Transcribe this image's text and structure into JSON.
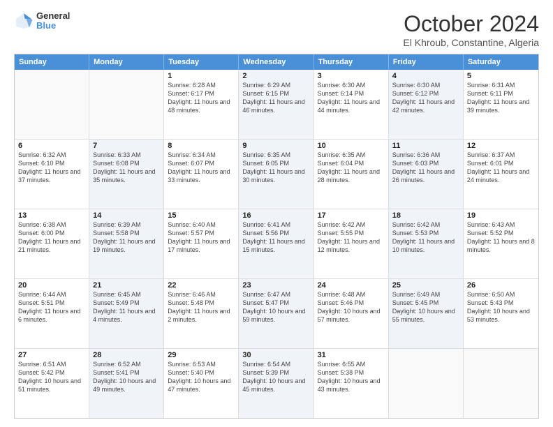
{
  "logo": {
    "line1": "General",
    "line2": "Blue"
  },
  "title": "October 2024",
  "subtitle": "El Khroub, Constantine, Algeria",
  "header_days": [
    "Sunday",
    "Monday",
    "Tuesday",
    "Wednesday",
    "Thursday",
    "Friday",
    "Saturday"
  ],
  "weeks": [
    [
      {
        "day": "",
        "sunrise": "",
        "sunset": "",
        "daylight": "",
        "shaded": false,
        "empty": true
      },
      {
        "day": "",
        "sunrise": "",
        "sunset": "",
        "daylight": "",
        "shaded": false,
        "empty": true
      },
      {
        "day": "1",
        "sunrise": "Sunrise: 6:28 AM",
        "sunset": "Sunset: 6:17 PM",
        "daylight": "Daylight: 11 hours and 48 minutes.",
        "shaded": false,
        "empty": false
      },
      {
        "day": "2",
        "sunrise": "Sunrise: 6:29 AM",
        "sunset": "Sunset: 6:15 PM",
        "daylight": "Daylight: 11 hours and 46 minutes.",
        "shaded": true,
        "empty": false
      },
      {
        "day": "3",
        "sunrise": "Sunrise: 6:30 AM",
        "sunset": "Sunset: 6:14 PM",
        "daylight": "Daylight: 11 hours and 44 minutes.",
        "shaded": false,
        "empty": false
      },
      {
        "day": "4",
        "sunrise": "Sunrise: 6:30 AM",
        "sunset": "Sunset: 6:12 PM",
        "daylight": "Daylight: 11 hours and 42 minutes.",
        "shaded": true,
        "empty": false
      },
      {
        "day": "5",
        "sunrise": "Sunrise: 6:31 AM",
        "sunset": "Sunset: 6:11 PM",
        "daylight": "Daylight: 11 hours and 39 minutes.",
        "shaded": false,
        "empty": false
      }
    ],
    [
      {
        "day": "6",
        "sunrise": "Sunrise: 6:32 AM",
        "sunset": "Sunset: 6:10 PM",
        "daylight": "Daylight: 11 hours and 37 minutes.",
        "shaded": false,
        "empty": false
      },
      {
        "day": "7",
        "sunrise": "Sunrise: 6:33 AM",
        "sunset": "Sunset: 6:08 PM",
        "daylight": "Daylight: 11 hours and 35 minutes.",
        "shaded": true,
        "empty": false
      },
      {
        "day": "8",
        "sunrise": "Sunrise: 6:34 AM",
        "sunset": "Sunset: 6:07 PM",
        "daylight": "Daylight: 11 hours and 33 minutes.",
        "shaded": false,
        "empty": false
      },
      {
        "day": "9",
        "sunrise": "Sunrise: 6:35 AM",
        "sunset": "Sunset: 6:05 PM",
        "daylight": "Daylight: 11 hours and 30 minutes.",
        "shaded": true,
        "empty": false
      },
      {
        "day": "10",
        "sunrise": "Sunrise: 6:35 AM",
        "sunset": "Sunset: 6:04 PM",
        "daylight": "Daylight: 11 hours and 28 minutes.",
        "shaded": false,
        "empty": false
      },
      {
        "day": "11",
        "sunrise": "Sunrise: 6:36 AM",
        "sunset": "Sunset: 6:03 PM",
        "daylight": "Daylight: 11 hours and 26 minutes.",
        "shaded": true,
        "empty": false
      },
      {
        "day": "12",
        "sunrise": "Sunrise: 6:37 AM",
        "sunset": "Sunset: 6:01 PM",
        "daylight": "Daylight: 11 hours and 24 minutes.",
        "shaded": false,
        "empty": false
      }
    ],
    [
      {
        "day": "13",
        "sunrise": "Sunrise: 6:38 AM",
        "sunset": "Sunset: 6:00 PM",
        "daylight": "Daylight: 11 hours and 21 minutes.",
        "shaded": false,
        "empty": false
      },
      {
        "day": "14",
        "sunrise": "Sunrise: 6:39 AM",
        "sunset": "Sunset: 5:58 PM",
        "daylight": "Daylight: 11 hours and 19 minutes.",
        "shaded": true,
        "empty": false
      },
      {
        "day": "15",
        "sunrise": "Sunrise: 6:40 AM",
        "sunset": "Sunset: 5:57 PM",
        "daylight": "Daylight: 11 hours and 17 minutes.",
        "shaded": false,
        "empty": false
      },
      {
        "day": "16",
        "sunrise": "Sunrise: 6:41 AM",
        "sunset": "Sunset: 5:56 PM",
        "daylight": "Daylight: 11 hours and 15 minutes.",
        "shaded": true,
        "empty": false
      },
      {
        "day": "17",
        "sunrise": "Sunrise: 6:42 AM",
        "sunset": "Sunset: 5:55 PM",
        "daylight": "Daylight: 11 hours and 12 minutes.",
        "shaded": false,
        "empty": false
      },
      {
        "day": "18",
        "sunrise": "Sunrise: 6:42 AM",
        "sunset": "Sunset: 5:53 PM",
        "daylight": "Daylight: 11 hours and 10 minutes.",
        "shaded": true,
        "empty": false
      },
      {
        "day": "19",
        "sunrise": "Sunrise: 6:43 AM",
        "sunset": "Sunset: 5:52 PM",
        "daylight": "Daylight: 11 hours and 8 minutes.",
        "shaded": false,
        "empty": false
      }
    ],
    [
      {
        "day": "20",
        "sunrise": "Sunrise: 6:44 AM",
        "sunset": "Sunset: 5:51 PM",
        "daylight": "Daylight: 11 hours and 6 minutes.",
        "shaded": false,
        "empty": false
      },
      {
        "day": "21",
        "sunrise": "Sunrise: 6:45 AM",
        "sunset": "Sunset: 5:49 PM",
        "daylight": "Daylight: 11 hours and 4 minutes.",
        "shaded": true,
        "empty": false
      },
      {
        "day": "22",
        "sunrise": "Sunrise: 6:46 AM",
        "sunset": "Sunset: 5:48 PM",
        "daylight": "Daylight: 11 hours and 2 minutes.",
        "shaded": false,
        "empty": false
      },
      {
        "day": "23",
        "sunrise": "Sunrise: 6:47 AM",
        "sunset": "Sunset: 5:47 PM",
        "daylight": "Daylight: 10 hours and 59 minutes.",
        "shaded": true,
        "empty": false
      },
      {
        "day": "24",
        "sunrise": "Sunrise: 6:48 AM",
        "sunset": "Sunset: 5:46 PM",
        "daylight": "Daylight: 10 hours and 57 minutes.",
        "shaded": false,
        "empty": false
      },
      {
        "day": "25",
        "sunrise": "Sunrise: 6:49 AM",
        "sunset": "Sunset: 5:45 PM",
        "daylight": "Daylight: 10 hours and 55 minutes.",
        "shaded": true,
        "empty": false
      },
      {
        "day": "26",
        "sunrise": "Sunrise: 6:50 AM",
        "sunset": "Sunset: 5:43 PM",
        "daylight": "Daylight: 10 hours and 53 minutes.",
        "shaded": false,
        "empty": false
      }
    ],
    [
      {
        "day": "27",
        "sunrise": "Sunrise: 6:51 AM",
        "sunset": "Sunset: 5:42 PM",
        "daylight": "Daylight: 10 hours and 51 minutes.",
        "shaded": false,
        "empty": false
      },
      {
        "day": "28",
        "sunrise": "Sunrise: 6:52 AM",
        "sunset": "Sunset: 5:41 PM",
        "daylight": "Daylight: 10 hours and 49 minutes.",
        "shaded": true,
        "empty": false
      },
      {
        "day": "29",
        "sunrise": "Sunrise: 6:53 AM",
        "sunset": "Sunset: 5:40 PM",
        "daylight": "Daylight: 10 hours and 47 minutes.",
        "shaded": false,
        "empty": false
      },
      {
        "day": "30",
        "sunrise": "Sunrise: 6:54 AM",
        "sunset": "Sunset: 5:39 PM",
        "daylight": "Daylight: 10 hours and 45 minutes.",
        "shaded": true,
        "empty": false
      },
      {
        "day": "31",
        "sunrise": "Sunrise: 6:55 AM",
        "sunset": "Sunset: 5:38 PM",
        "daylight": "Daylight: 10 hours and 43 minutes.",
        "shaded": false,
        "empty": false
      },
      {
        "day": "",
        "sunrise": "",
        "sunset": "",
        "daylight": "",
        "shaded": true,
        "empty": true
      },
      {
        "day": "",
        "sunrise": "",
        "sunset": "",
        "daylight": "",
        "shaded": false,
        "empty": true
      }
    ]
  ]
}
